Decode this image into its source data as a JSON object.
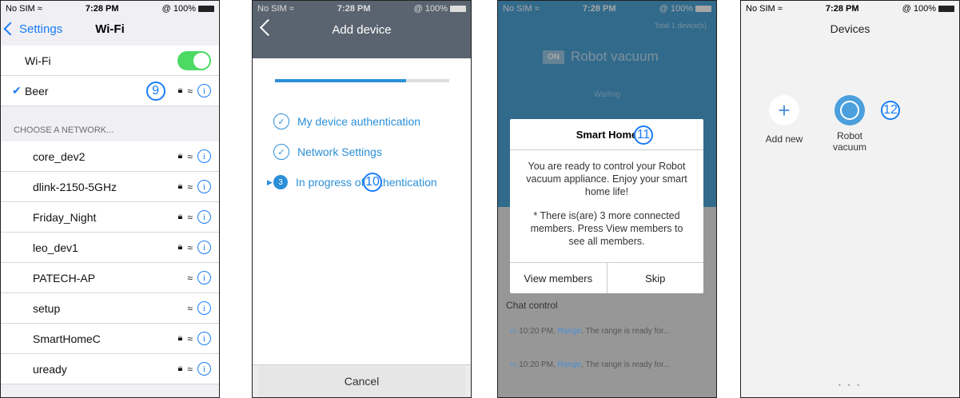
{
  "phone1": {
    "status": {
      "carrier": "No SIM ≈",
      "time": "7:28 PM",
      "battery": "@ 100%"
    },
    "back_label": "Settings",
    "title": "Wi-Fi",
    "wifi_label": "Wi-Fi",
    "connected_network": "Beer",
    "badge": "9",
    "section_header": "CHOOSE A NETWORK...",
    "networks": [
      {
        "name": "core_dev2",
        "locked": true
      },
      {
        "name": "dlink-2150-5GHz",
        "locked": true
      },
      {
        "name": "Friday_Night",
        "locked": true
      },
      {
        "name": "leo_dev1",
        "locked": true
      },
      {
        "name": "PATECH-AP",
        "locked": false
      },
      {
        "name": "setup",
        "locked": false
      },
      {
        "name": "SmartHomeC",
        "locked": true
      },
      {
        "name": "uready",
        "locked": true
      }
    ]
  },
  "phone2": {
    "status": {
      "carrier": "No SIM ≈",
      "time": "7:28 PM",
      "battery": "@ 100%"
    },
    "title": "Add device",
    "progress": 0.75,
    "steps": [
      {
        "label": "My device authentication",
        "state": "done"
      },
      {
        "label": "Network Settings",
        "state": "done"
      },
      {
        "label": "In progress of authentication",
        "state": "current",
        "number": "3"
      }
    ],
    "badge": "10",
    "cancel_label": "Cancel"
  },
  "phone3": {
    "status": {
      "carrier": "No SIM ≈",
      "time": "7:28 PM",
      "battery": "@ 100%"
    },
    "total_devices": "Total 1 device(s)",
    "on_badge": "ON",
    "device_name": "Robot vacuum",
    "device_state": "Waiting",
    "chat_label": "Chat control",
    "chat_items": [
      {
        "time": "10:20 PM,",
        "who": "Range",
        "text": ", The range is ready for..."
      },
      {
        "time": "10:20 PM,",
        "who": "Range",
        "text": ", The range is ready for..."
      }
    ],
    "dialog": {
      "title": "Smart Home",
      "message1": "You are ready to control your Robot vacuum appliance. Enjoy your smart home life!",
      "message2": "* There is(are) 3 more connected members. Press View members to see all members.",
      "btn_view": "View members",
      "btn_skip": "Skip"
    },
    "badge": "11"
  },
  "phone4": {
    "status": {
      "carrier": "No SIM ≈",
      "time": "7:28 PM",
      "battery": "@ 100%"
    },
    "title": "Devices",
    "add_new_label": "Add new",
    "device_label": "Robot vacuum",
    "badge": "12",
    "page_dots": "• • •"
  },
  "colors": {
    "ios_blue": "#1a7cf6",
    "toggle_green": "#4cd964",
    "app_blue": "#4da3d6",
    "header_gray": "#5a6470"
  }
}
